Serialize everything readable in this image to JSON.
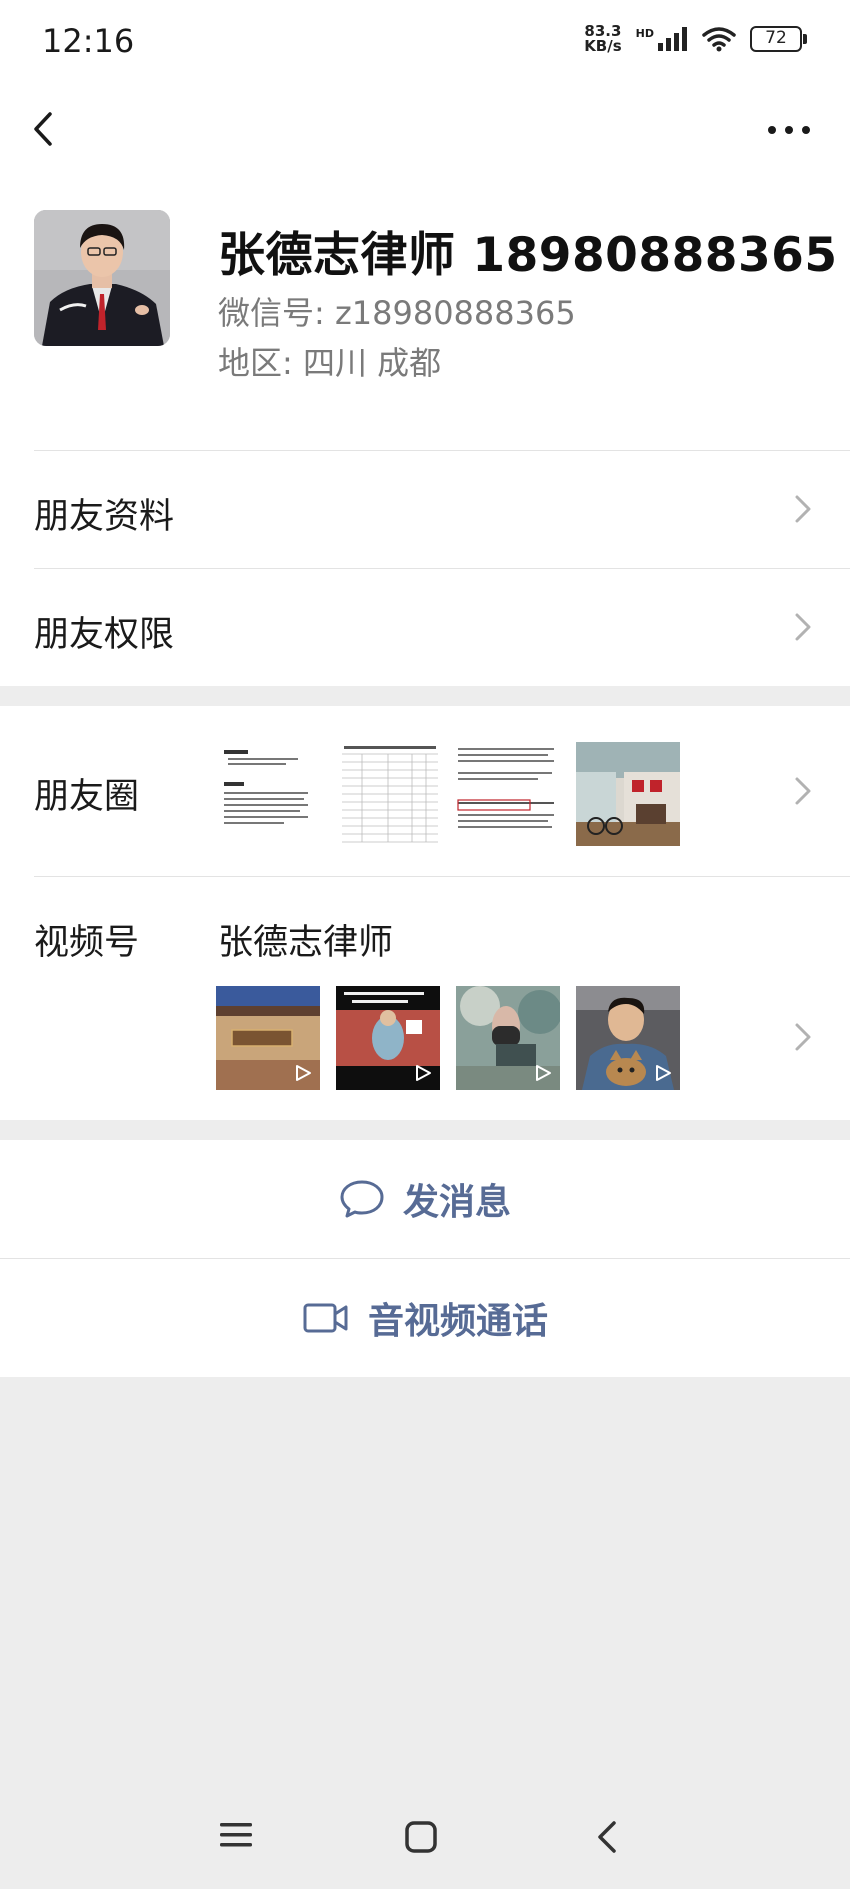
{
  "status_bar": {
    "time": "12:16",
    "net_speed_value": "83.3",
    "net_speed_unit": "KB/s",
    "network_type": "HD",
    "battery": "72"
  },
  "nav": {
    "back_icon": "back-arrow-icon",
    "more_icon": "more-dots-icon"
  },
  "profile": {
    "name": "张德志律师 18980888365",
    "wechat_id": "微信号: z18980888365",
    "region": "地区: 四川  成都"
  },
  "menu": {
    "friend_info": "朋友资料",
    "friend_permission": "朋友权限",
    "moments": "朋友圈",
    "channels": "视频号",
    "channels_name": "张德志律师"
  },
  "actions": {
    "send_message": "发消息",
    "av_call": "音视频通话"
  },
  "colors": {
    "link": "#576b95",
    "background": "#ededed",
    "verify_icon": "#5b9bd5"
  }
}
